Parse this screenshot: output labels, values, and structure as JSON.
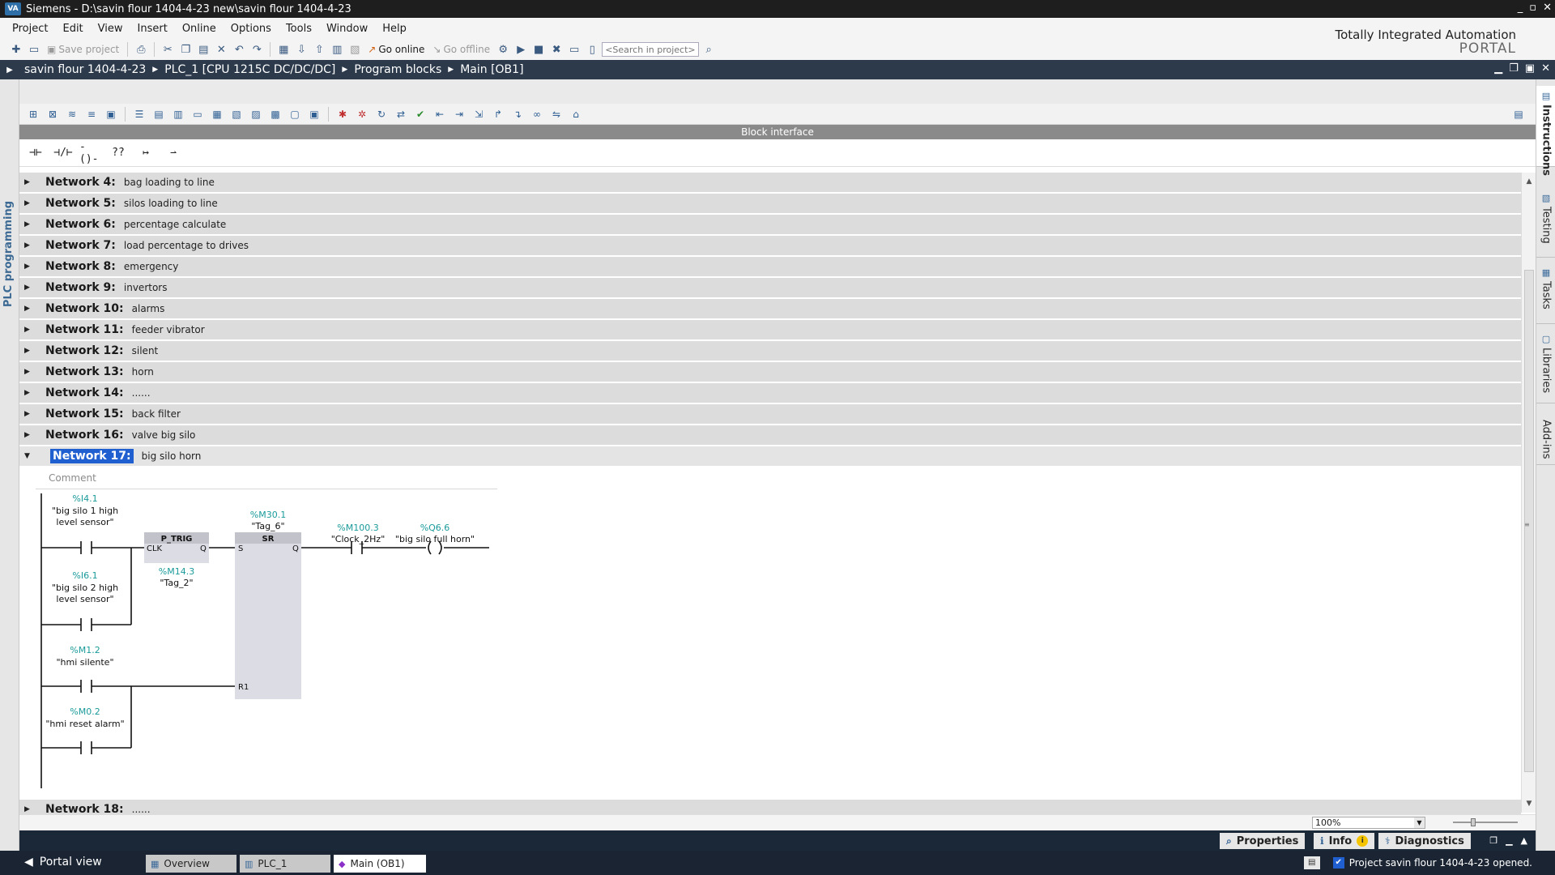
{
  "window": {
    "title": "Siemens  -  D:\\savin flour 1404-4-23 new\\savin flour 1404-4-23",
    "logo": "VA",
    "controls": [
      "_",
      "▫",
      "✕"
    ]
  },
  "menu": [
    "Project",
    "Edit",
    "View",
    "Insert",
    "Online",
    "Options",
    "Tools",
    "Window",
    "Help"
  ],
  "toolbar": {
    "save_label": "Save project",
    "go_online_label": "Go online",
    "go_offline_label": "Go offline",
    "search_placeholder": "<Search in project>"
  },
  "brand": {
    "line1": "Totally Integrated Automation",
    "line2": "PORTAL"
  },
  "breadcrumb": [
    "savin flour 1404-4-23",
    "PLC_1 [CPU 1215C DC/DC/DC]",
    "Program blocks",
    "Main [OB1]"
  ],
  "left_tab": "PLC programming",
  "right_tabs": [
    "Instructions",
    "Testing",
    "Tasks",
    "Libraries",
    "Add-ins"
  ],
  "editor": {
    "block_interface_label": "Block interface",
    "favorites": [
      "⊣⊢",
      "⊣/⊢",
      "-()-",
      "??",
      "↦",
      "⇀"
    ],
    "networks": [
      {
        "name": "Network 4:",
        "comment": "bag loading to line"
      },
      {
        "name": "Network 5:",
        "comment": "silos loading to line"
      },
      {
        "name": "Network 6:",
        "comment": "percentage calculate"
      },
      {
        "name": "Network 7:",
        "comment": "load percentage to drives"
      },
      {
        "name": "Network 8:",
        "comment": "emergency"
      },
      {
        "name": "Network 9:",
        "comment": "invertors"
      },
      {
        "name": "Network 10:",
        "comment": "alarms"
      },
      {
        "name": "Network 11:",
        "comment": "feeder vibrator"
      },
      {
        "name": "Network 12:",
        "comment": "silent"
      },
      {
        "name": "Network 13:",
        "comment": "horn"
      },
      {
        "name": "Network 14:",
        "comment": "......"
      },
      {
        "name": "Network 15:",
        "comment": "back filter"
      },
      {
        "name": "Network 16:",
        "comment": "valve big silo"
      }
    ],
    "open_network": {
      "name": "Network 17:",
      "comment": "big silo horn",
      "comment_placeholder": "Comment"
    },
    "last_network": {
      "name": "Network 18:",
      "comment": "......"
    },
    "ladder": {
      "contacts": [
        {
          "addr": "%I4.1",
          "line1": "\"big silo 1  high",
          "line2": "level sensor\""
        },
        {
          "addr": "%I6.1",
          "line1": "\"big silo 2 high",
          "line2": "level sensor\""
        },
        {
          "addr": "%M1.2",
          "line1": "\"hmi silente\"",
          "line2": ""
        },
        {
          "addr": "%M0.2",
          "line1": "\"hmi reset alarm\"",
          "line2": ""
        }
      ],
      "ptrig": {
        "title": "P_TRIG",
        "in": "CLK",
        "out": "Q",
        "addr": "%M14.3",
        "tag": "\"Tag_2\""
      },
      "sr": {
        "title": "SR",
        "addr": "%M30.1",
        "tag": "\"Tag_6\"",
        "s": "S",
        "q": "Q",
        "r": "R1"
      },
      "clock": {
        "addr": "%M100.3",
        "tag": "\"Clock_2Hz\""
      },
      "coil": {
        "addr": "%Q6.6",
        "tag": "\"big silo full horn\""
      }
    },
    "zoom": "100%"
  },
  "inspector_tabs": {
    "properties": "Properties",
    "info": "Info",
    "diagnostics": "Diagnostics"
  },
  "statusbar": {
    "portal_view": "Portal view",
    "tabs": [
      "Overview",
      "PLC_1",
      "Main (OB1)"
    ],
    "message": "Project savin flour 1404-4-23 opened."
  },
  "colors": {
    "address_teal": "#1a9a9a",
    "selection_blue": "#1f5fd0",
    "crumb_bar": "#2c3a4c"
  }
}
